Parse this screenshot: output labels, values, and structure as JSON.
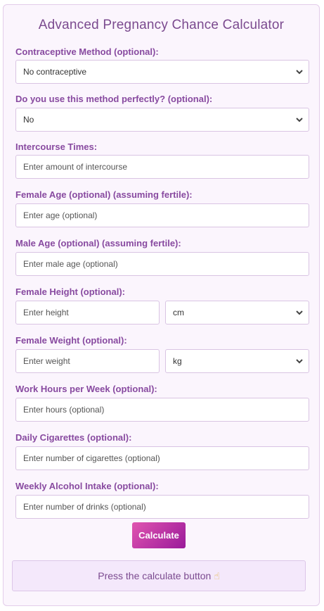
{
  "title": "Advanced Pregnancy Chance Calculator",
  "fields": {
    "contraceptive": {
      "label": "Contraceptive Method (optional):",
      "value": "No contraceptive"
    },
    "perfect_use": {
      "label": "Do you use this method perfectly? (optional):",
      "value": "No"
    },
    "intercourse": {
      "label": "Intercourse Times:",
      "placeholder": "Enter amount of intercourse"
    },
    "female_age": {
      "label": "Female Age (optional) (assuming fertile):",
      "placeholder": "Enter age (optional)"
    },
    "male_age": {
      "label": "Male Age (optional) (assuming fertile):",
      "placeholder": "Enter male age (optional)"
    },
    "female_height": {
      "label": "Female Height (optional):",
      "placeholder": "Enter height",
      "unit": "cm"
    },
    "female_weight": {
      "label": "Female Weight (optional):",
      "placeholder": "Enter weight",
      "unit": "kg"
    },
    "work_hours": {
      "label": "Work Hours per Week (optional):",
      "placeholder": "Enter hours (optional)"
    },
    "cigarettes": {
      "label": "Daily Cigarettes (optional):",
      "placeholder": "Enter number of cigarettes (optional)"
    },
    "alcohol": {
      "label": "Weekly Alcohol Intake (optional):",
      "placeholder": "Enter number of drinks (optional)"
    }
  },
  "calculate_label": "Calculate",
  "result": {
    "text": "Press the calculate button",
    "icon": "pointing-hand-icon"
  },
  "colors": {
    "accent": "#884aa0",
    "button_start": "#e054b0",
    "button_end": "#9a1a9a",
    "background": "#fbf5fd"
  }
}
